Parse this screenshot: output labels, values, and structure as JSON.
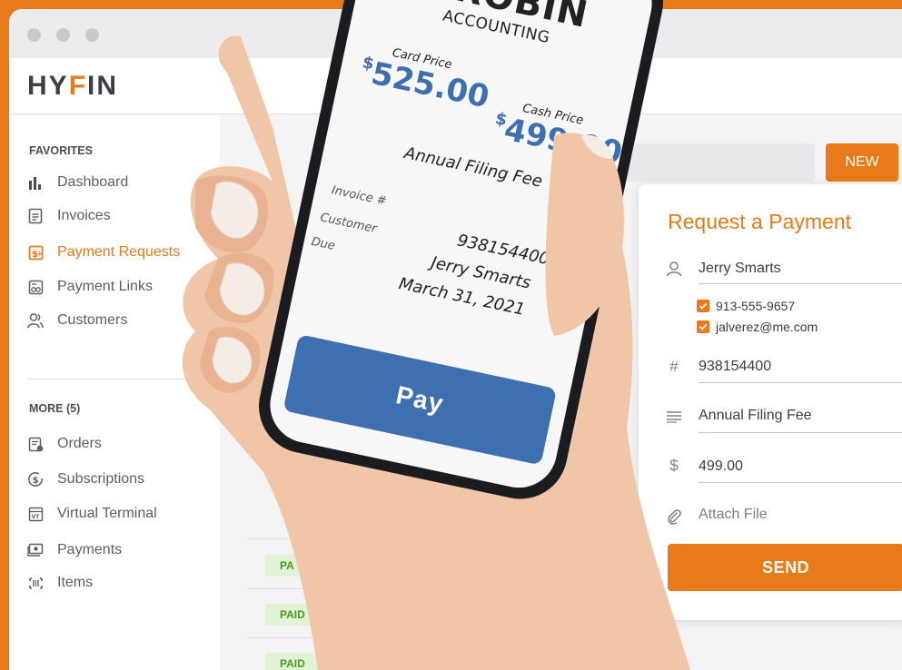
{
  "app": {
    "brand_prefix": "HY",
    "brand_accent": "F",
    "brand_suffix": "IN"
  },
  "sidebar": {
    "favorites_label": "FAVORITES",
    "favorites": [
      {
        "label": "Dashboard",
        "icon": "bar-chart-icon"
      },
      {
        "label": "Invoices",
        "icon": "invoice-icon"
      },
      {
        "label": "Payment Requests",
        "icon": "payment-request-icon",
        "active": true
      },
      {
        "label": "Payment Links",
        "icon": "payment-link-icon"
      },
      {
        "label": "Customers",
        "icon": "customers-icon"
      }
    ],
    "more_label": "MORE (5)",
    "more": [
      {
        "label": "Orders",
        "icon": "orders-icon"
      },
      {
        "label": "Subscriptions",
        "icon": "subscriptions-icon"
      },
      {
        "label": "Virtual Terminal",
        "icon": "virtual-terminal-icon"
      },
      {
        "label": "Payments",
        "icon": "payments-icon"
      },
      {
        "label": "Items",
        "icon": "items-icon"
      }
    ]
  },
  "toolbar": {
    "new_label": "NEW"
  },
  "table": {
    "status_badges": [
      "PA",
      "PAID",
      "PAID"
    ]
  },
  "request_form": {
    "title": "Request a Payment",
    "customer": "Jerry Smarts",
    "phone": "913-555-9657",
    "email": "jalverez@me.com",
    "invoice_number": "938154400",
    "description": "Annual Filing Fee",
    "amount": "499.00",
    "attach_label": "Attach File",
    "send_label": "SEND"
  },
  "phone": {
    "company_name": "ROBIN",
    "company_sub": "ACCOUNTING",
    "card_price_label": "Card Price",
    "card_price_currency": "$",
    "card_price": "525.00",
    "cash_price_label": "Cash Price",
    "cash_price_currency": "$",
    "cash_price": "499.00",
    "item": "Annual Filing Fee",
    "invoice_label": "Invoice #",
    "customer_label": "Customer",
    "due_label": "Due",
    "invoice_value": "938154400",
    "customer_value": "Jerry Smarts",
    "due_value": "March 31, 2021",
    "pay_label": "Pay"
  },
  "colors": {
    "accent": "#e97a1a",
    "pay_blue": "#3e6fb0",
    "paid_green": "#4a9a22"
  }
}
